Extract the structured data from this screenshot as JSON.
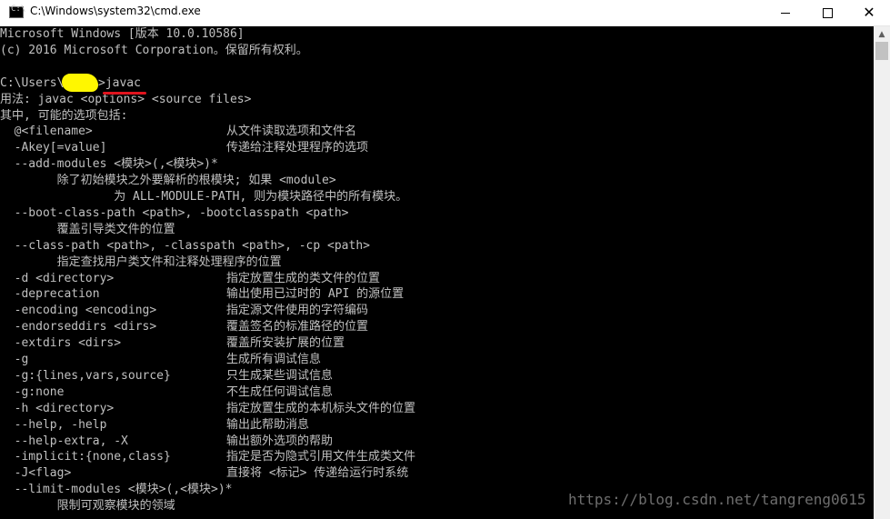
{
  "window": {
    "title": "C:\\Windows\\system32\\cmd.exe",
    "icon": "cmd-icon",
    "icon_glyph": "C:\\",
    "buttons": {
      "minimize": "minimize-icon",
      "maximize": "maximize-icon",
      "close": "close-icon",
      "close_glyph": "✕"
    }
  },
  "console": {
    "lines": [
      [
        "Microsoft Windows [版本 10.0.10586]"
      ],
      [
        "(c) 2016 Microsoft Corporation。保留所有权利。"
      ],
      [
        ""
      ],
      [
        "C:\\Users\\",
        ">javac"
      ],
      [
        "用法: javac <options> <source files>"
      ],
      [
        "其中, 可能的选项包括:"
      ],
      [
        "  @<filename>",
        "从文件读取选项和文件名"
      ],
      [
        "  -Akey[=value]",
        "传递给注释处理程序的选项"
      ],
      [
        "  --add-modules <模块>(,<模块>)*"
      ],
      [
        "        除了初始模块之外要解析的根模块; 如果 <module>"
      ],
      [
        "                为 ALL-MODULE-PATH, 则为模块路径中的所有模块。"
      ],
      [
        "  --boot-class-path <path>, -bootclasspath <path>"
      ],
      [
        "        覆盖引导类文件的位置"
      ],
      [
        "  --class-path <path>, -classpath <path>, -cp <path>"
      ],
      [
        "        指定查找用户类文件和注释处理程序的位置"
      ],
      [
        "  -d <directory>",
        "指定放置生成的类文件的位置"
      ],
      [
        "  -deprecation",
        "输出使用已过时的 API 的源位置"
      ],
      [
        "  -encoding <encoding>",
        "指定源文件使用的字符编码"
      ],
      [
        "  -endorseddirs <dirs>",
        "覆盖签名的标准路径的位置"
      ],
      [
        "  -extdirs <dirs>",
        "覆盖所安装扩展的位置"
      ],
      [
        "  -g",
        "生成所有调试信息"
      ],
      [
        "  -g:{lines,vars,source}",
        "只生成某些调试信息"
      ],
      [
        "  -g:none",
        "不生成任何调试信息"
      ],
      [
        "  -h <directory>",
        "指定放置生成的本机标头文件的位置"
      ],
      [
        "  --help, -help",
        "输出此帮助消息"
      ],
      [
        "  --help-extra, -X",
        "输出额外选项的帮助"
      ],
      [
        "  -implicit:{none,class}",
        "指定是否为隐式引用文件生成类文件"
      ],
      [
        "  -J<flag>",
        "直接将 <标记> 传递给运行时系统"
      ],
      [
        "  --limit-modules <模块>(,<模块>)*"
      ],
      [
        "        限制可观察模块的领域"
      ]
    ],
    "text_color": "#c0c0c0",
    "background": "#000000"
  },
  "watermark": "https://blog.csdn.net/tangreng0615",
  "colors": {
    "redaction": "#fff700",
    "annotation_underline": "#e0141e"
  }
}
